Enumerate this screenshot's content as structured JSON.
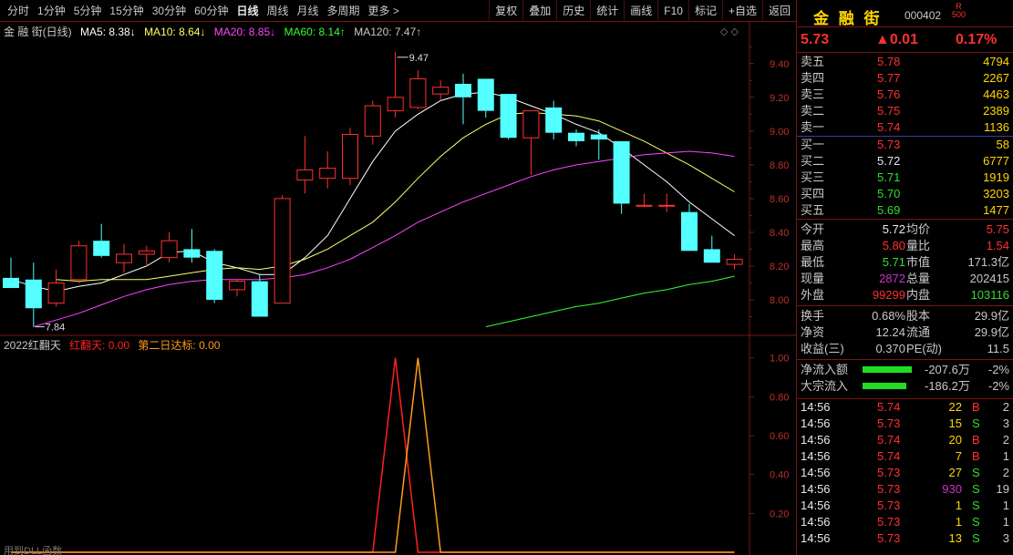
{
  "toolbar": {
    "periods": [
      "分时",
      "1分钟",
      "5分钟",
      "15分钟",
      "30分钟",
      "60分钟",
      "日线",
      "周线",
      "月线",
      "多周期",
      "更多 >"
    ],
    "active_index": 6,
    "actions": [
      "复权",
      "叠加",
      "历史",
      "统计",
      "画线",
      "F10",
      "标记",
      "+自选",
      "返回"
    ]
  },
  "main_legend": {
    "name": "金 融 街(日线)",
    "ma5": "MA5: 8.38↓",
    "ma10": "MA10: 8.64↓",
    "ma20": "MA20: 8.85↓",
    "ma60": "MA60: 8.14↑",
    "ma120": "MA120: 7.47↑",
    "ctrl": "◇ ◇"
  },
  "sub_legend": {
    "name": "2022红翻天",
    "v1": "红翻天: 0.00",
    "v2": "第二日达标: 0.00"
  },
  "footer_text": "用到DLL函数",
  "colors": {
    "up": "#ff3030",
    "down": "#54ffff",
    "ma5": "#ffffff",
    "ma10": "#ffff66",
    "ma20": "#ff44ff",
    "ma60": "#33ff33",
    "sig1": "#ff2020",
    "sig2": "#ff9a1a",
    "grid": "#7a1414"
  },
  "chart_data": [
    {
      "type": "candlestick",
      "ylim": [
        7.8,
        9.55
      ],
      "yticks": [
        "9.40",
        "9.20",
        "9.00",
        "8.80",
        "8.60",
        "8.40",
        "8.20",
        "8.00"
      ],
      "annotations": {
        "high": "9.47",
        "low": "7.84"
      },
      "candles": [
        {
          "o": 8.13,
          "h": 8.25,
          "l": 8.07,
          "c": 8.07
        },
        {
          "o": 8.12,
          "h": 8.22,
          "l": 7.84,
          "c": 7.95
        },
        {
          "o": 7.98,
          "h": 8.18,
          "l": 7.96,
          "c": 8.1
        },
        {
          "o": 8.12,
          "h": 8.35,
          "l": 8.1,
          "c": 8.32
        },
        {
          "o": 8.35,
          "h": 8.45,
          "l": 8.25,
          "c": 8.26
        },
        {
          "o": 8.22,
          "h": 8.33,
          "l": 8.16,
          "c": 8.27
        },
        {
          "o": 8.27,
          "h": 8.32,
          "l": 8.2,
          "c": 8.29
        },
        {
          "o": 8.25,
          "h": 8.4,
          "l": 8.22,
          "c": 8.35
        },
        {
          "o": 8.3,
          "h": 8.42,
          "l": 8.22,
          "c": 8.25
        },
        {
          "o": 8.29,
          "h": 8.3,
          "l": 7.98,
          "c": 8.0
        },
        {
          "o": 8.06,
          "h": 8.12,
          "l": 8.02,
          "c": 8.11
        },
        {
          "o": 8.11,
          "h": 8.15,
          "l": 7.9,
          "c": 7.9
        },
        {
          "o": 7.98,
          "h": 8.62,
          "l": 7.98,
          "c": 8.6
        },
        {
          "o": 8.71,
          "h": 8.97,
          "l": 8.63,
          "c": 8.77
        },
        {
          "o": 8.72,
          "h": 8.88,
          "l": 8.66,
          "c": 8.78
        },
        {
          "o": 8.72,
          "h": 9.02,
          "l": 8.68,
          "c": 8.98
        },
        {
          "o": 8.97,
          "h": 9.18,
          "l": 8.92,
          "c": 9.15
        },
        {
          "o": 9.12,
          "h": 9.47,
          "l": 9.08,
          "c": 9.2
        },
        {
          "o": 9.14,
          "h": 9.36,
          "l": 9.13,
          "c": 9.31
        },
        {
          "o": 9.22,
          "h": 9.3,
          "l": 9.18,
          "c": 9.26
        },
        {
          "o": 9.28,
          "h": 9.34,
          "l": 9.04,
          "c": 9.2
        },
        {
          "o": 9.31,
          "h": 9.31,
          "l": 9.08,
          "c": 9.12
        },
        {
          "o": 9.22,
          "h": 9.22,
          "l": 8.95,
          "c": 8.96
        },
        {
          "o": 8.96,
          "h": 9.1,
          "l": 8.74,
          "c": 9.12
        },
        {
          "o": 9.14,
          "h": 9.18,
          "l": 8.95,
          "c": 8.99
        },
        {
          "o": 8.99,
          "h": 9.01,
          "l": 8.91,
          "c": 8.94
        },
        {
          "o": 8.98,
          "h": 9.01,
          "l": 8.83,
          "c": 8.95
        },
        {
          "o": 8.94,
          "h": 8.94,
          "l": 8.51,
          "c": 8.57
        },
        {
          "o": 8.56,
          "h": 8.63,
          "l": 8.55,
          "c": 8.56
        },
        {
          "o": 8.56,
          "h": 8.63,
          "l": 8.52,
          "c": 8.56
        },
        {
          "o": 8.52,
          "h": 8.57,
          "l": 8.29,
          "c": 8.29
        },
        {
          "o": 8.3,
          "h": 8.38,
          "l": 8.22,
          "c": 8.22
        },
        {
          "o": 8.21,
          "h": 8.27,
          "l": 8.18,
          "c": 8.24
        }
      ],
      "series": [
        {
          "name": "MA5",
          "values": [
            8.12,
            8.08,
            8.05,
            8.08,
            8.1,
            8.15,
            8.2,
            8.28,
            8.29,
            8.22,
            8.19,
            8.15,
            8.15,
            8.25,
            8.38,
            8.6,
            8.82,
            9.0,
            9.1,
            9.18,
            9.22,
            9.23,
            9.2,
            9.15,
            9.1,
            9.04,
            8.99,
            8.9,
            8.8,
            8.7,
            8.58,
            8.48,
            8.38
          ]
        },
        {
          "name": "MA10",
          "values": [
            null,
            null,
            8.12,
            8.11,
            8.12,
            8.12,
            8.12,
            8.14,
            8.16,
            8.18,
            8.19,
            8.18,
            8.2,
            8.24,
            8.3,
            8.38,
            8.46,
            8.58,
            8.72,
            8.85,
            8.96,
            9.04,
            9.1,
            9.11,
            9.1,
            9.09,
            9.06,
            9.0,
            8.94,
            8.87,
            8.8,
            8.72,
            8.64
          ]
        },
        {
          "name": "MA20",
          "values": [
            null,
            7.84,
            7.88,
            7.92,
            7.97,
            8.02,
            8.06,
            8.09,
            8.11,
            8.12,
            8.12,
            8.12,
            8.13,
            8.15,
            8.19,
            8.24,
            8.31,
            8.38,
            8.46,
            8.52,
            8.58,
            8.63,
            8.68,
            8.73,
            8.77,
            8.8,
            8.82,
            8.84,
            8.86,
            8.87,
            8.88,
            8.87,
            8.85
          ]
        },
        {
          "name": "MA60",
          "values": [
            null,
            null,
            null,
            null,
            null,
            null,
            null,
            null,
            null,
            null,
            null,
            null,
            null,
            null,
            null,
            null,
            null,
            null,
            null,
            null,
            null,
            7.84,
            7.87,
            7.9,
            7.93,
            7.96,
            7.98,
            8.01,
            8.04,
            8.06,
            8.09,
            8.11,
            8.14
          ]
        }
      ]
    },
    {
      "type": "line",
      "ylim": [
        0,
        1.05
      ],
      "yticks": [
        "1.00",
        "0.80",
        "0.60",
        "0.40",
        "0.20"
      ],
      "series": [
        {
          "name": "红翻天",
          "values": [
            0,
            0,
            0,
            0,
            0,
            0,
            0,
            0,
            0,
            0,
            0,
            0,
            0,
            0,
            0,
            0,
            0,
            1,
            0,
            0,
            0,
            0,
            0,
            0,
            0,
            0,
            0,
            0,
            0,
            0,
            0,
            0,
            0
          ]
        },
        {
          "name": "第二日达标",
          "values": [
            0,
            0,
            0,
            0,
            0,
            0,
            0,
            0,
            0,
            0,
            0,
            0,
            0,
            0,
            0,
            0,
            0,
            0,
            1,
            0,
            0,
            0,
            0,
            0,
            0,
            0,
            0,
            0,
            0,
            0,
            0,
            0,
            0
          ]
        }
      ]
    }
  ],
  "quote": {
    "name": "金 融 街",
    "code": "000402",
    "tag1": "R",
    "tag2": "500",
    "price": "5.73",
    "change": "▲0.01",
    "pct": "0.17%",
    "sells": [
      {
        "label": "卖五",
        "price": "5.78",
        "vol": "4794"
      },
      {
        "label": "卖四",
        "price": "5.77",
        "vol": "2267"
      },
      {
        "label": "卖三",
        "price": "5.76",
        "vol": "4463"
      },
      {
        "label": "卖二",
        "price": "5.75",
        "vol": "2389"
      },
      {
        "label": "卖一",
        "price": "5.74",
        "vol": "1136"
      }
    ],
    "buys": [
      {
        "label": "买一",
        "price": "5.73",
        "vol": "58",
        "pc": "red"
      },
      {
        "label": "买二",
        "price": "5.72",
        "vol": "6777",
        "pc": "white"
      },
      {
        "label": "买三",
        "price": "5.71",
        "vol": "1919",
        "pc": "green"
      },
      {
        "label": "买四",
        "price": "5.70",
        "vol": "3203",
        "pc": "green"
      },
      {
        "label": "买五",
        "price": "5.69",
        "vol": "1477",
        "pc": "green"
      }
    ],
    "stats": [
      {
        "l1": "今开",
        "v1": "5.72",
        "c1": "white",
        "l2": "均价",
        "v2": "5.75",
        "c2": "red"
      },
      {
        "l1": "最高",
        "v1": "5.80",
        "c1": "red",
        "l2": "量比",
        "v2": "1.54",
        "c2": "red"
      },
      {
        "l1": "最低",
        "v1": "5.71",
        "c1": "green",
        "l2": "市值",
        "v2": "171.3亿",
        "c2": "grey"
      },
      {
        "l1": "现量",
        "v1": "2872",
        "c1": "purple",
        "l2": "总量",
        "v2": "202415",
        "c2": "grey"
      },
      {
        "l1": "外盘",
        "v1": "99299",
        "c1": "red",
        "l2": "内盘",
        "v2": "103116",
        "c2": "green"
      }
    ],
    "fund": [
      {
        "l1": "换手",
        "v1": "0.68%",
        "l2": "股本",
        "v2": "29.9亿"
      },
      {
        "l1": "净资",
        "v1": "12.24",
        "l2": "流通",
        "v2": "29.9亿"
      },
      {
        "l1": "收益(三)",
        "v1": "0.370",
        "l2": "PE(动)",
        "v2": "11.5"
      }
    ],
    "flows": [
      {
        "label": "净流入额",
        "value": "-207.6万",
        "pct": "-2%"
      },
      {
        "label": "大宗流入",
        "value": "-186.2万",
        "pct": "-2%"
      }
    ],
    "ticks": [
      {
        "t": "14:56",
        "p": "5.74",
        "pc": "red",
        "v": "22",
        "vc": "yellow",
        "d": "B",
        "dc": "red",
        "n": "2"
      },
      {
        "t": "14:56",
        "p": "5.73",
        "pc": "red",
        "v": "15",
        "vc": "yellow",
        "d": "S",
        "dc": "green",
        "n": "3"
      },
      {
        "t": "14:56",
        "p": "5.74",
        "pc": "red",
        "v": "20",
        "vc": "yellow",
        "d": "B",
        "dc": "red",
        "n": "2"
      },
      {
        "t": "14:56",
        "p": "5.74",
        "pc": "red",
        "v": "7",
        "vc": "yellow",
        "d": "B",
        "dc": "red",
        "n": "1"
      },
      {
        "t": "14:56",
        "p": "5.73",
        "pc": "red",
        "v": "27",
        "vc": "yellow",
        "d": "S",
        "dc": "green",
        "n": "2"
      },
      {
        "t": "14:56",
        "p": "5.73",
        "pc": "red",
        "v": "930",
        "vc": "purple",
        "d": "S",
        "dc": "green",
        "n": "19"
      },
      {
        "t": "14:56",
        "p": "5.73",
        "pc": "red",
        "v": "1",
        "vc": "yellow",
        "d": "S",
        "dc": "green",
        "n": "1"
      },
      {
        "t": "14:56",
        "p": "5.73",
        "pc": "red",
        "v": "1",
        "vc": "yellow",
        "d": "S",
        "dc": "green",
        "n": "1"
      },
      {
        "t": "14:56",
        "p": "5.73",
        "pc": "red",
        "v": "13",
        "vc": "yellow",
        "d": "S",
        "dc": "green",
        "n": "3"
      }
    ]
  }
}
